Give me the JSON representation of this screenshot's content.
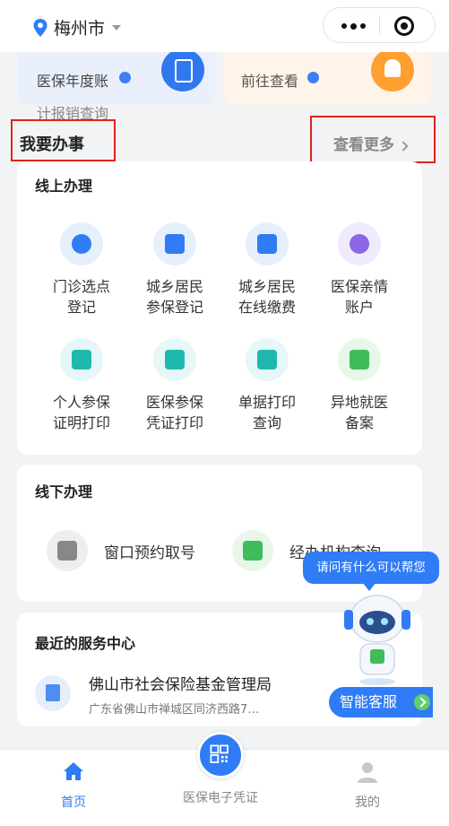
{
  "topbar": {
    "city": "梅州市"
  },
  "cards": {
    "left_text": "医保年度账",
    "right_text": "前往查看"
  },
  "faded_text": "计报销查询",
  "section": {
    "title": "我要办事",
    "more": "查看更多"
  },
  "online": {
    "title": "线上办理",
    "items": [
      {
        "line1": "门诊选点",
        "line2": "登记"
      },
      {
        "line1": "城乡居民",
        "line2": "参保登记"
      },
      {
        "line1": "城乡居民",
        "line2": "在线缴费"
      },
      {
        "line1": "医保亲情",
        "line2": "账户"
      },
      {
        "line1": "个人参保",
        "line2": "证明打印"
      },
      {
        "line1": "医保参保",
        "line2": "凭证打印"
      },
      {
        "line1": "单据打印",
        "line2": "查询"
      },
      {
        "line1": "异地就医",
        "line2": "备案"
      }
    ]
  },
  "offline": {
    "title": "线下办理",
    "items": [
      {
        "label": "窗口预约取号"
      },
      {
        "label": "经办机构查询"
      }
    ]
  },
  "recent": {
    "title": "最近的服务中心",
    "name": "佛山市社会保险基金管理局",
    "address": "广东省佛山市禅城区同济西路7…"
  },
  "service": {
    "bubble": "请问有什么可以帮您",
    "button": "智能客服"
  },
  "tabbar": {
    "home": "首页",
    "card": "医保电子凭证",
    "mine": "我的"
  },
  "colors": {
    "accent": "#2f7cf6",
    "highlight": "#e0241b"
  }
}
